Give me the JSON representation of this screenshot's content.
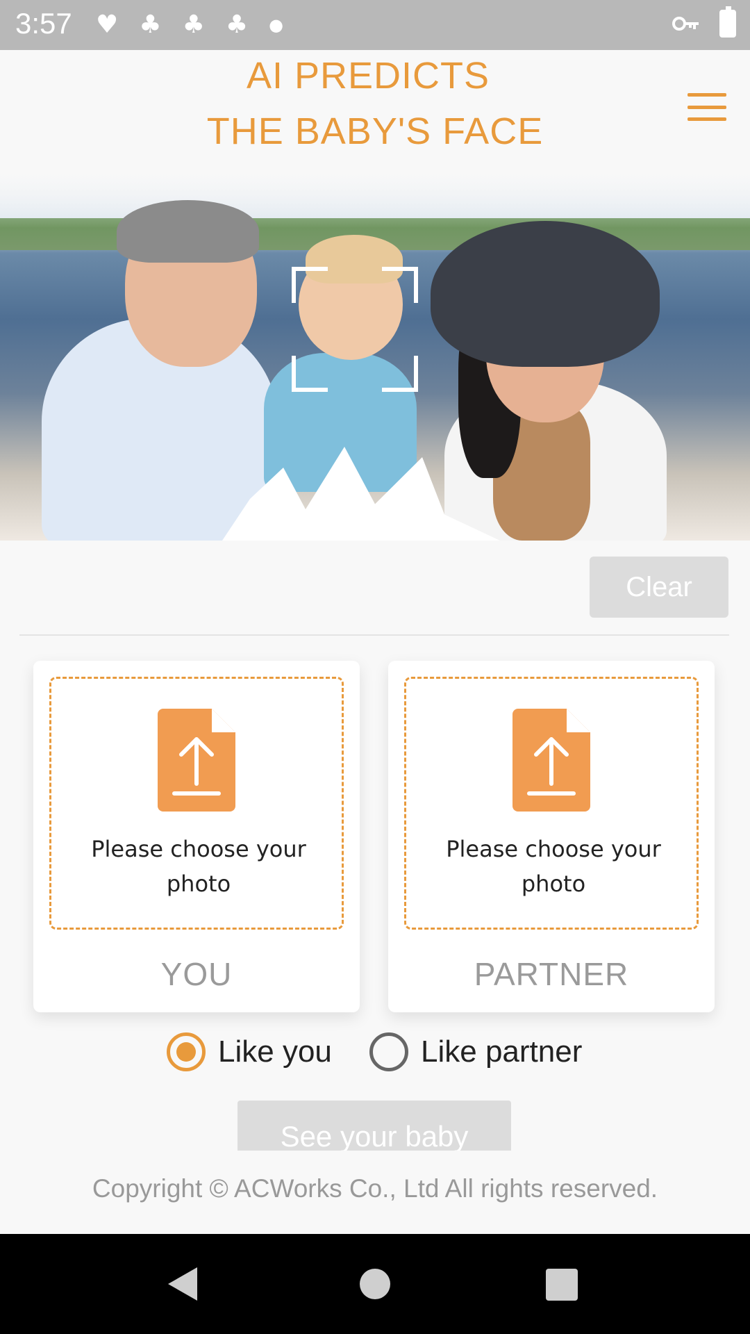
{
  "status_bar": {
    "time": "3:57",
    "left_icons": [
      "heart-pulse-icon",
      "palm-tree-icon",
      "palm-tree-icon",
      "palm-tree-icon",
      "dot-icon"
    ],
    "right_icons": [
      "key-icon",
      "battery-charging-icon"
    ]
  },
  "header": {
    "title_line1": "AI PREDICTS",
    "title_line2": "THE BABY'S FACE",
    "menu_icon": "hamburger-menu-icon"
  },
  "actions": {
    "clear_label": "Clear"
  },
  "cards": [
    {
      "prompt": "Please choose your photo",
      "label": "YOU",
      "icon": "file-upload-icon"
    },
    {
      "prompt": "Please choose your photo",
      "label": "PARTNER",
      "icon": "file-upload-icon"
    }
  ],
  "likeness": {
    "options": [
      {
        "label": "Like you",
        "selected": true
      },
      {
        "label": "Like partner",
        "selected": false
      }
    ]
  },
  "see_baby_label": "See your baby",
  "footer": {
    "copyright": "Copyright © ACWorks Co., Ltd All rights reserved."
  },
  "colors": {
    "accent": "#e89a3c",
    "status_bar": "#b8b8b8",
    "button_disabled": "#dcdcdc",
    "background": "#f8f8f8"
  }
}
